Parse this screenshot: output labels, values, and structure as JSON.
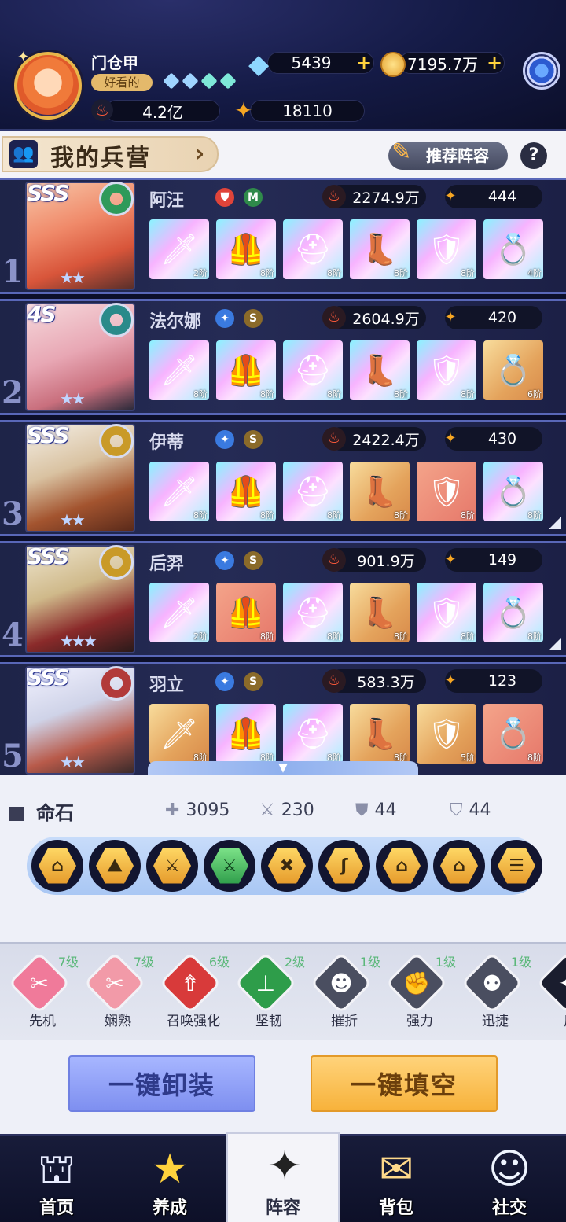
{
  "player": {
    "name": "门仓甲",
    "title": "好看的",
    "diamonds": "5439",
    "gold": "7195.7万",
    "power": "4.2亿",
    "energy": "18110"
  },
  "camp": {
    "title": "我的兵营",
    "recommend_label": "推荐阵容",
    "help_label": "?"
  },
  "heroes": [
    {
      "index": "1",
      "rank": "SSS",
      "name": "阿汪",
      "grade": "M",
      "power": "2274.9万",
      "energy": "444",
      "equips": [
        "2阶",
        "8阶",
        "8阶",
        "8阶",
        "8阶",
        "4阶"
      ]
    },
    {
      "index": "2",
      "rank": "4S",
      "name": "法尔娜",
      "grade": "S",
      "power": "2604.9万",
      "energy": "420",
      "equips": [
        "8阶",
        "8阶",
        "8阶",
        "8阶",
        "8阶",
        "6阶"
      ]
    },
    {
      "index": "3",
      "rank": "SSS",
      "name": "伊蒂",
      "grade": "S",
      "power": "2422.4万",
      "energy": "430",
      "equips": [
        "8阶",
        "8阶",
        "8阶",
        "8阶",
        "8阶",
        "8阶"
      ]
    },
    {
      "index": "4",
      "rank": "SSS",
      "name": "后羿",
      "grade": "S",
      "power": "901.9万",
      "energy": "149",
      "equips": [
        "2阶",
        "8阶",
        "8阶",
        "8阶",
        "8阶",
        "8阶"
      ]
    },
    {
      "index": "5",
      "rank": "SSS",
      "name": "羽立",
      "grade": "S",
      "power": "583.3万",
      "energy": "123",
      "equips": [
        "8阶",
        "8阶",
        "8阶",
        "8阶",
        "5阶",
        "8阶"
      ]
    }
  ],
  "stone": {
    "title": "命石",
    "hp": "3095",
    "atk": "230",
    "def": "44",
    "res": "44"
  },
  "skills": [
    {
      "name": "先机",
      "level": "7级"
    },
    {
      "name": "娴熟",
      "level": "7级"
    },
    {
      "name": "召唤强化",
      "level": "6级"
    },
    {
      "name": "坚韧",
      "level": "2级"
    },
    {
      "name": "摧折",
      "level": "1级"
    },
    {
      "name": "强力",
      "level": "1级"
    },
    {
      "name": "迅捷",
      "level": "1级"
    },
    {
      "name": "魔",
      "level": ""
    }
  ],
  "buttons": {
    "unequip_all": "一键卸装",
    "fill_all": "一键填空"
  },
  "nav": [
    "首页",
    "养成",
    "阵容",
    "背包",
    "社交"
  ],
  "colors": {
    "accent": "#5967b8",
    "gold": "#ffd23d",
    "power_red": "#e0443a"
  }
}
